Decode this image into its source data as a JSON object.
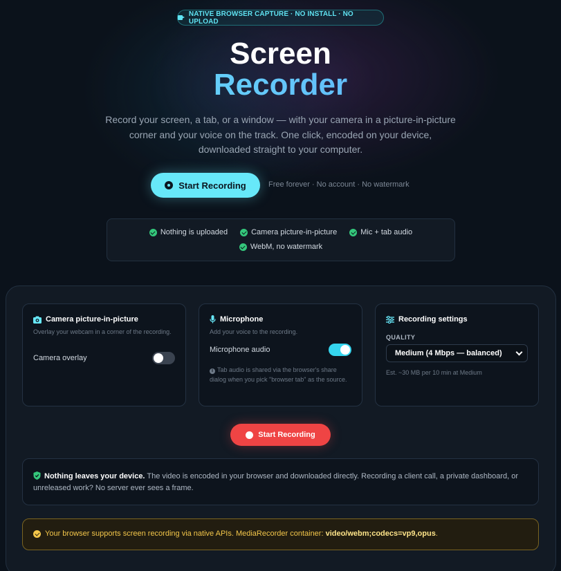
{
  "badge": {
    "icon": "video-camera-icon",
    "text": "NATIVE BROWSER CAPTURE · NO INSTALL · NO UPLOAD"
  },
  "hero": {
    "title_line1": "Screen",
    "title_line2": "Recorder",
    "tagline": "Record your screen, a tab, or a window — with your camera in a picture-in-picture corner and your voice on the track. One click, encoded on your device, downloaded straight to your computer.",
    "start_button": "Start Recording",
    "subnote": "Free forever · No account · No watermark"
  },
  "features": [
    {
      "icon": "check-circle-icon",
      "label": "Nothing is uploaded"
    },
    {
      "icon": "check-circle-icon",
      "label": "Camera picture-in-picture"
    },
    {
      "icon": "check-circle-icon",
      "label": "Mic + tab audio"
    },
    {
      "icon": "check-circle-icon",
      "label": "WebM, no watermark"
    }
  ],
  "camera_card": {
    "icon": "camera-icon",
    "title": "Camera picture-in-picture",
    "description": "Overlay your webcam in a corner of the recording.",
    "toggle_label": "Camera overlay",
    "toggle_on": false
  },
  "mic_card": {
    "icon": "microphone-icon",
    "title": "Microphone",
    "description": "Add your voice to the recording.",
    "toggle_label": "Microphone audio",
    "toggle_on": true,
    "hint": "Tab audio is shared via the browser's share dialog when you pick \"browser tab\" as the source."
  },
  "settings_card": {
    "icon": "sliders-icon",
    "title": "Recording settings",
    "quality_label": "QUALITY",
    "quality_value": "Medium (4 Mbps — balanced)",
    "estimate": "Est. ~30 MB per 10 min at Medium"
  },
  "record_button": "Start Recording",
  "privacy": {
    "icon": "shield-check-icon",
    "bold": "Nothing leaves your device.",
    "text": " The video is encoded in your browser and downloaded directly. Recording a client call, a private dashboard, or unreleased work? No server ever sees a frame."
  },
  "support": {
    "icon": "check-circle-icon",
    "text": "Your browser supports screen recording via native APIs. MediaRecorder container: ",
    "container": "video/webm;codecs=vp9,opus",
    "suffix": "."
  },
  "colors": {
    "accent": "#67e8f9",
    "record": "#ef4444",
    "success": "#34c77b",
    "warning": "#f3c64a",
    "background": "#0b121b"
  }
}
